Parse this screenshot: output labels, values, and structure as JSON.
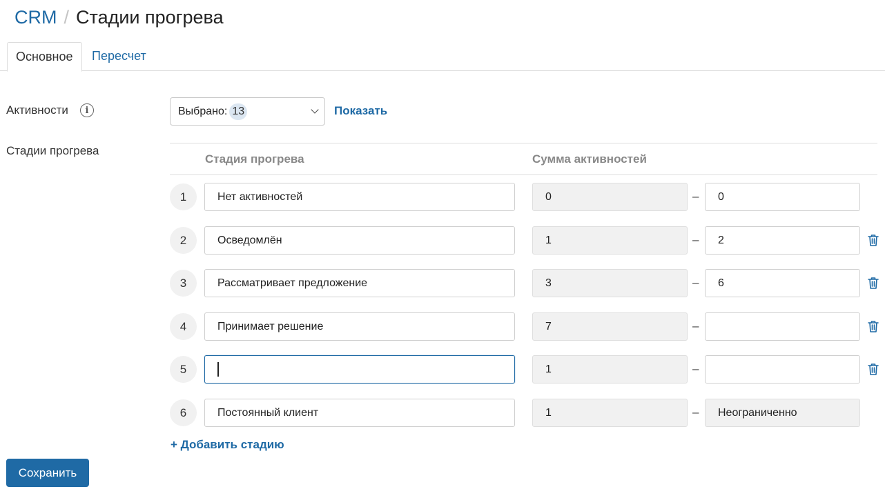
{
  "breadcrumb": {
    "root": "CRM",
    "separator": "/",
    "title": "Стадии прогрева"
  },
  "tabs": [
    {
      "label": "Основное",
      "active": true
    },
    {
      "label": "Пересчет",
      "active": false
    }
  ],
  "activities": {
    "label": "Активности",
    "info_icon": "info-icon",
    "select_prefix": "Выбрано:",
    "select_count": "13",
    "show_link": "Показать"
  },
  "stages": {
    "label": "Стадии прогрева",
    "columns": {
      "stage": "Стадия прогрева",
      "sum": "Сумма активностей"
    },
    "dash": "–",
    "rows": [
      {
        "num": "1",
        "name": "Нет активностей",
        "from": "0",
        "to": "0"
      },
      {
        "num": "2",
        "name": "Осведомлён",
        "from": "1",
        "to": "2"
      },
      {
        "num": "3",
        "name": "Рассматривает предложение",
        "from": "3",
        "to": "6"
      },
      {
        "num": "4",
        "name": "Принимает решение",
        "from": "7",
        "to": ""
      },
      {
        "num": "5",
        "name": "",
        "from": "1",
        "to": ""
      },
      {
        "num": "6",
        "name": "Постоянный клиент",
        "from": "1",
        "to": "Неограниченно"
      }
    ],
    "add_label": "+ Добавить стадию"
  },
  "save_label": "Сохранить",
  "colors": {
    "accent": "#1f6aa5",
    "readonly_bg": "#f1f1f1",
    "border": "#dcdcdc"
  }
}
